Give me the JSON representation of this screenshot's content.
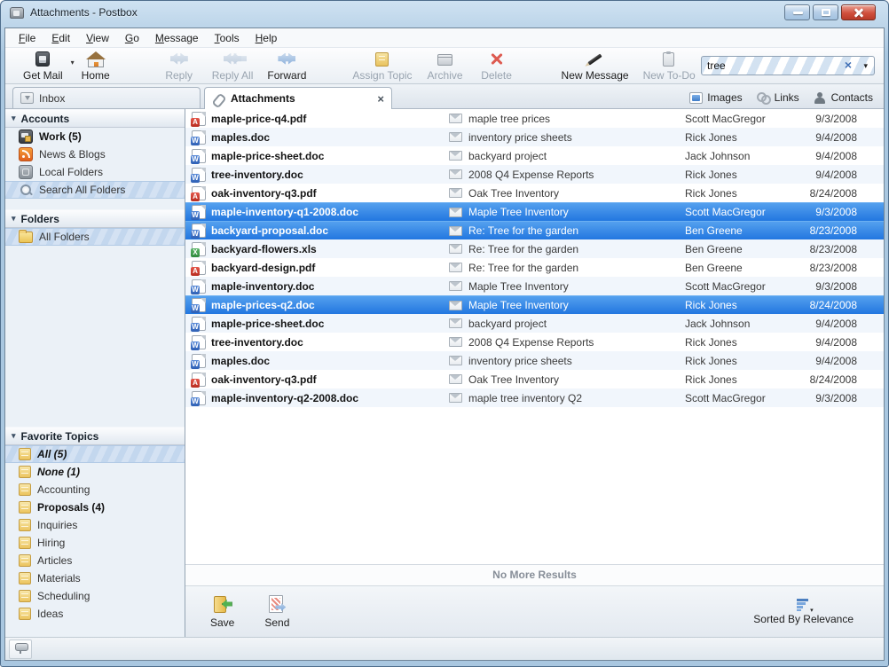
{
  "window": {
    "title": "Attachments - Postbox"
  },
  "icons": {
    "collapse_glyph": "▾",
    "dropdown_glyph": "▾",
    "close_glyph": "×",
    "clear_glyph": "×"
  },
  "menubar": {
    "items": [
      {
        "name": "menu-file",
        "label": "File"
      },
      {
        "name": "menu-edit",
        "label": "Edit"
      },
      {
        "name": "menu-view",
        "label": "View"
      },
      {
        "name": "menu-go",
        "label": "Go"
      },
      {
        "name": "menu-message",
        "label": "Message"
      },
      {
        "name": "menu-tools",
        "label": "Tools"
      },
      {
        "name": "menu-help",
        "label": "Help"
      }
    ]
  },
  "toolbar": {
    "group1": [
      {
        "name": "get-mail-button",
        "label": "Get Mail",
        "icon": "get-mail",
        "dropdown": true
      },
      {
        "name": "home-button",
        "label": "Home",
        "icon": "home"
      }
    ],
    "group2": [
      {
        "name": "reply-button",
        "label": "Reply",
        "icon": "reply",
        "disabled": true
      },
      {
        "name": "reply-all-button",
        "label": "Reply All",
        "icon": "reply-all",
        "disabled": true
      },
      {
        "name": "forward-button",
        "label": "Forward",
        "icon": "forward"
      }
    ],
    "group3": [
      {
        "name": "assign-topic-button",
        "label": "Assign Topic",
        "icon": "assign-topic",
        "disabled": true
      },
      {
        "name": "archive-button",
        "label": "Archive",
        "icon": "archive",
        "disabled": true
      },
      {
        "name": "delete-button",
        "label": "Delete",
        "icon": "delete",
        "disabled": true
      }
    ],
    "group4": [
      {
        "name": "new-message-button",
        "label": "New Message",
        "icon": "new-message"
      },
      {
        "name": "new-todo-button",
        "label": "New To-Do",
        "icon": "new-todo",
        "disabled": true
      }
    ],
    "search": {
      "value": "tree"
    }
  },
  "tabs": {
    "items": [
      {
        "name": "tab-inbox",
        "label": "Inbox",
        "icon": "inbox"
      },
      {
        "name": "tab-attachments",
        "label": "Attachments",
        "icon": "paperclip",
        "active": true,
        "closable": true
      }
    ],
    "right_links": [
      {
        "name": "images-filter",
        "label": "Images",
        "icon": "images"
      },
      {
        "name": "links-filter",
        "label": "Links",
        "icon": "links"
      },
      {
        "name": "contacts-filter",
        "label": "Contacts",
        "icon": "contacts"
      }
    ]
  },
  "sidebar": {
    "accounts": {
      "title": "Accounts",
      "items": [
        {
          "name": "sidebar-item-work",
          "label": "Work (5)",
          "icon": "work-account",
          "bold": true
        },
        {
          "name": "sidebar-item-news-blogs",
          "label": "News & Blogs",
          "icon": "rss"
        },
        {
          "name": "sidebar-item-local-folders",
          "label": "Local Folders",
          "icon": "local-folders"
        },
        {
          "name": "sidebar-item-search-all-folders",
          "label": "Search All Folders",
          "icon": "search",
          "selected": true
        }
      ]
    },
    "folders": {
      "title": "Folders",
      "items": [
        {
          "name": "sidebar-item-all-folders",
          "label": "All Folders",
          "icon": "folder",
          "selected": true
        }
      ]
    },
    "topics": {
      "title": "Favorite Topics",
      "items": [
        {
          "name": "topic-item-all",
          "label": "All (5)",
          "icon": "topic",
          "bold": true,
          "italic": true,
          "selected": true
        },
        {
          "name": "topic-item-none",
          "label": "None (1)",
          "icon": "topic",
          "bold": true,
          "italic": true
        },
        {
          "name": "topic-item-accounting",
          "label": "Accounting",
          "icon": "topic"
        },
        {
          "name": "topic-item-proposals",
          "label": "Proposals (4)",
          "icon": "topic",
          "bold": true
        },
        {
          "name": "topic-item-inquiries",
          "label": "Inquiries",
          "icon": "topic"
        },
        {
          "name": "topic-item-hiring",
          "label": "Hiring",
          "icon": "topic"
        },
        {
          "name": "topic-item-articles",
          "label": "Articles",
          "icon": "topic"
        },
        {
          "name": "topic-item-materials",
          "label": "Materials",
          "icon": "topic"
        },
        {
          "name": "topic-item-scheduling",
          "label": "Scheduling",
          "icon": "topic"
        },
        {
          "name": "topic-item-ideas",
          "label": "Ideas",
          "icon": "topic"
        }
      ]
    }
  },
  "results": {
    "rows": [
      {
        "file": "maple-price-q4.pdf",
        "type": "pdf",
        "subject": "maple tree prices",
        "sender": "Scott MacGregor",
        "date": "9/3/2008"
      },
      {
        "file": "maples.doc",
        "type": "doc",
        "subject": "inventory price sheets",
        "sender": "Rick Jones",
        "date": "9/4/2008"
      },
      {
        "file": "maple-price-sheet.doc",
        "type": "doc",
        "subject": "backyard project",
        "sender": "Jack Johnson",
        "date": "9/4/2008"
      },
      {
        "file": "tree-inventory.doc",
        "type": "doc",
        "subject": "2008 Q4 Expense Reports",
        "sender": "Rick Jones",
        "date": "9/4/2008"
      },
      {
        "file": "oak-inventory-q3.pdf",
        "type": "pdf",
        "subject": "Oak Tree Inventory",
        "sender": "Rick Jones",
        "date": "8/24/2008"
      },
      {
        "file": "maple-inventory-q1-2008.doc",
        "type": "doc",
        "subject": "Maple Tree Inventory",
        "sender": "Scott MacGregor",
        "date": "9/3/2008",
        "selected": true
      },
      {
        "file": "backyard-proposal.doc",
        "type": "doc",
        "subject": "Re: Tree for the garden",
        "sender": "Ben Greene",
        "date": "8/23/2008",
        "selected": true
      },
      {
        "file": "backyard-flowers.xls",
        "type": "xls",
        "subject": "Re: Tree for the garden",
        "sender": "Ben Greene",
        "date": "8/23/2008"
      },
      {
        "file": "backyard-design.pdf",
        "type": "pdf",
        "subject": "Re: Tree for the garden",
        "sender": "Ben Greene",
        "date": "8/23/2008"
      },
      {
        "file": "maple-inventory.doc",
        "type": "doc",
        "subject": "Maple Tree Inventory",
        "sender": "Scott MacGregor",
        "date": "9/3/2008"
      },
      {
        "file": "maple-prices-q2.doc",
        "type": "doc",
        "subject": "Maple Tree Inventory",
        "sender": "Rick Jones",
        "date": "8/24/2008",
        "selected": true
      },
      {
        "file": "maple-price-sheet.doc",
        "type": "doc",
        "subject": "backyard project",
        "sender": "Jack Johnson",
        "date": "9/4/2008"
      },
      {
        "file": "tree-inventory.doc",
        "type": "doc",
        "subject": "2008 Q4 Expense Reports",
        "sender": "Rick Jones",
        "date": "9/4/2008"
      },
      {
        "file": "maples.doc",
        "type": "doc",
        "subject": "inventory price sheets",
        "sender": "Rick Jones",
        "date": "9/4/2008"
      },
      {
        "file": "oak-inventory-q3.pdf",
        "type": "pdf",
        "subject": "Oak Tree Inventory",
        "sender": "Rick Jones",
        "date": "8/24/2008"
      },
      {
        "file": "maple-inventory-q2-2008.doc",
        "type": "doc",
        "subject": "maple tree inventory Q2",
        "sender": "Scott MacGregor",
        "date": "9/3/2008"
      }
    ],
    "no_more": "No More Results"
  },
  "footer": {
    "save_label": "Save",
    "send_label": "Send",
    "sort_label": "Sorted By Relevance"
  },
  "colors": {
    "selection_blue": "#2277e0",
    "titlebar_blue": "#a9c7e0",
    "close_red": "#c03a2b",
    "striped_selection": "#c3d7ee"
  }
}
